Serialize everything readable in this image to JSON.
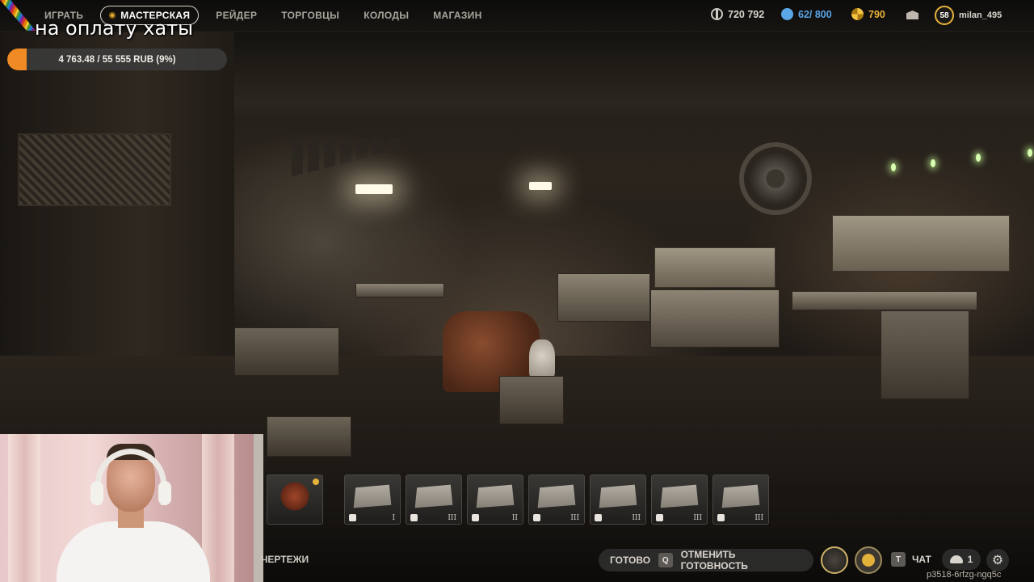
{
  "nav": {
    "items": [
      {
        "label": "ИГРАТЬ",
        "active": false
      },
      {
        "label": "МАСТЕРСКАЯ",
        "active": true
      },
      {
        "label": "РЕЙДЕР",
        "active": false
      },
      {
        "label": "ТОРГОВЦЫ",
        "active": false
      },
      {
        "label": "КОЛОДЫ",
        "active": false
      },
      {
        "label": "МАГАЗИН",
        "active": false
      }
    ]
  },
  "resources": {
    "koens": "720 792",
    "bonds": "62/ 800",
    "gold": "790",
    "level": "58",
    "username": "milan_495"
  },
  "overlay": {
    "title": "на оплату хаты",
    "progress_text": "4 763.48 / 55 555 RUB (9%)",
    "progress_fraction": 0.0858
  },
  "workbenches": {
    "slots": [
      {
        "name": "rooster",
        "icon": "rooster",
        "level": ""
      },
      {
        "name": "bench-1",
        "icon": "bed-icon",
        "level": "I"
      },
      {
        "name": "bench-2",
        "icon": "flask-icon",
        "level": "III"
      },
      {
        "name": "bench-3",
        "icon": "tool-icon",
        "level": "II"
      },
      {
        "name": "bench-4",
        "icon": "shield-icon",
        "level": "III"
      },
      {
        "name": "bench-5",
        "icon": "crossed-swords-icon",
        "level": "III"
      },
      {
        "name": "bench-6",
        "icon": "medical-cross-icon",
        "level": "III"
      },
      {
        "name": "bench-7",
        "icon": "recycle-icon",
        "level": "III"
      }
    ],
    "blueprints_label": "ЧЕРТЕЖИ"
  },
  "controls": {
    "ready_label": "ГОТОВО",
    "cancel_key": "Q",
    "cancel_label": "ОТМЕНИТЬ ГОТОВНОСТЬ",
    "chat_key": "T",
    "chat_label": "ЧАТ",
    "friends_count": "1",
    "server_id": "p3518-6rfzg-ngq5c"
  },
  "colors": {
    "accent": "#e7b23a",
    "progress": "#f08a24",
    "bonds": "#5aa6e6"
  }
}
